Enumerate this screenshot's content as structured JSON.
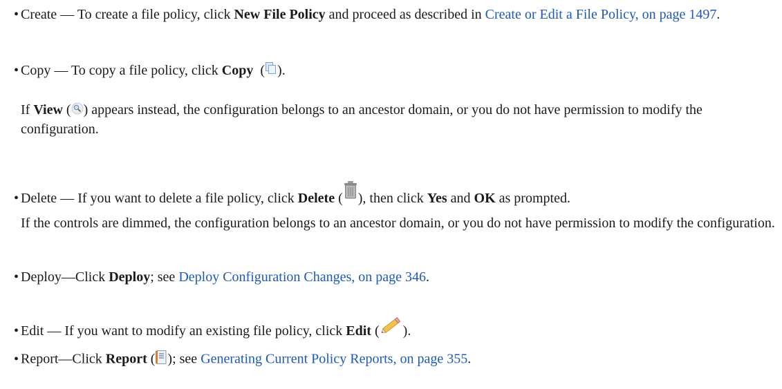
{
  "items": {
    "create": {
      "lead": "Create — To create a file policy, click ",
      "bold": "New File Policy",
      "mid": " and proceed as described in ",
      "link": "Create or Edit a File Policy, on page 1497",
      "end": "."
    },
    "copy": {
      "lead": "Copy — To copy a file policy, click ",
      "bold": "Copy",
      "end": ".",
      "note_pre": "If ",
      "note_bold": "View",
      "note_post": " appears instead, the configuration belongs to an ancestor domain, or you do not have permission to modify the configuration."
    },
    "delete": {
      "lead": "Delete — If you want to delete a file policy, click ",
      "bold": "Delete",
      "mid": ", then click ",
      "bold2": "Yes",
      "and": " and ",
      "bold3": "OK",
      "end": " as prompted.",
      "note": "If the controls are dimmed, the configuration belongs to an ancestor domain, or you do not have permission to modify the configuration."
    },
    "deploy": {
      "lead": "Deploy—Click ",
      "bold": "Deploy",
      "mid": "; see ",
      "link": "Deploy Configuration Changes, on page 346",
      "end": "."
    },
    "edit": {
      "lead": "Edit — If you want to modify an existing file policy, click ",
      "bold": "Edit",
      "end": "."
    },
    "report": {
      "lead": "Report—Click ",
      "bold": "Report",
      "mid": "; see ",
      "link": "Generating Current Policy Reports, on page 355",
      "end": "."
    }
  },
  "colors": {
    "link": "#1e5ab4",
    "text": "#1a1a1a"
  },
  "icons": [
    "copy-icon",
    "view-magnifier-icon",
    "delete-trash-icon",
    "edit-pencil-icon",
    "report-icon"
  ]
}
